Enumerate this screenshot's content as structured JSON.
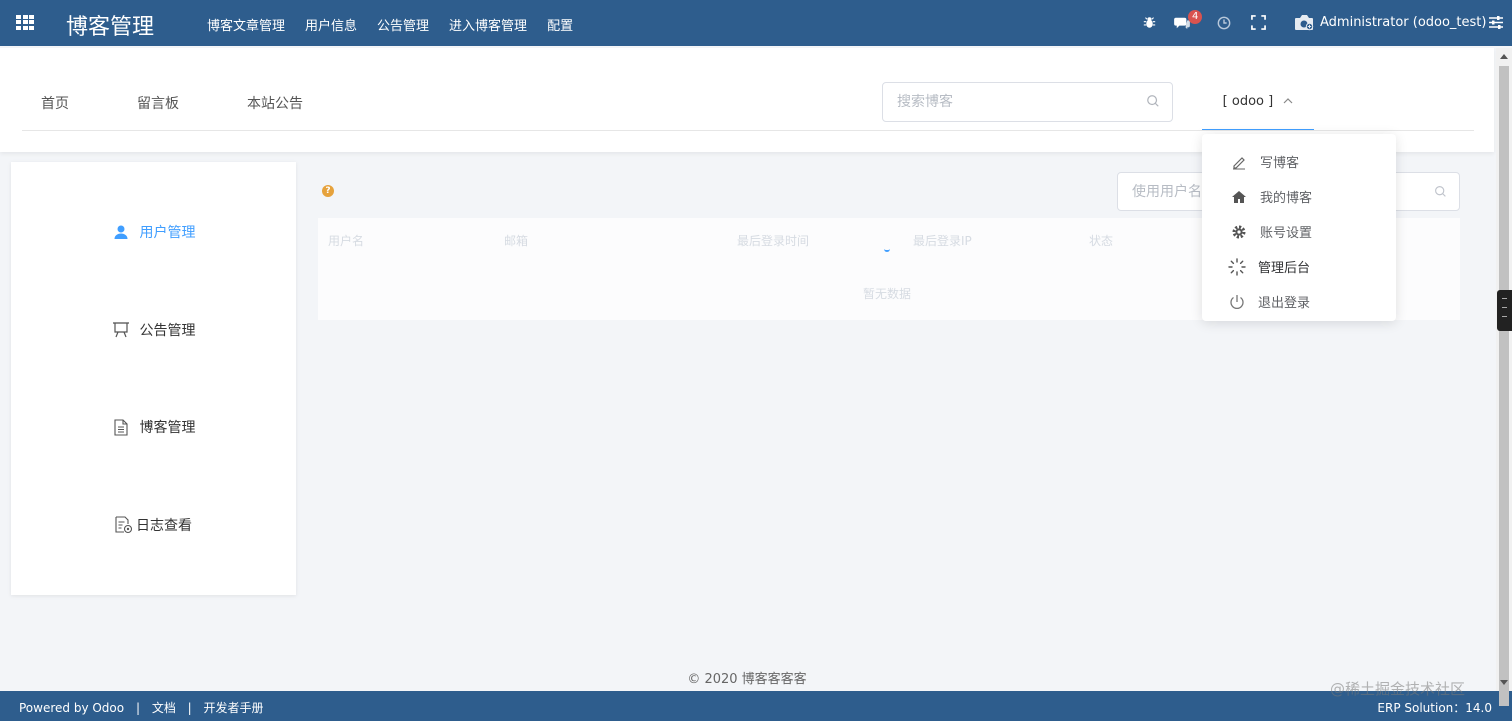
{
  "topbar": {
    "brand": "博客管理",
    "menu": [
      "博客文章管理",
      "用户信息",
      "公告管理",
      "进入博客管理",
      "配置"
    ],
    "message_count": "4",
    "user": "Administrator (odoo_test)"
  },
  "header": {
    "tabs": [
      "首页",
      "留言板",
      "本站公告"
    ],
    "search_placeholder": "搜索博客",
    "user_menu": "[ odoo ]"
  },
  "dropdown": {
    "items": [
      "写博客",
      "我的博客",
      "账号设置",
      "管理后台",
      "退出登录"
    ]
  },
  "sidebar": {
    "items": [
      "用户管理",
      "公告管理",
      "博客管理",
      "日志查看"
    ]
  },
  "content": {
    "user_search_placeholder": "使用用户名",
    "columns": [
      "用户名",
      "邮箱",
      "最后登录时间",
      "最后登录IP",
      "状态"
    ],
    "empty_text": "暂无数据"
  },
  "footer": {
    "copyright": "© 2020 博客客客客",
    "powered_by": "Powered by Odoo",
    "docs": "文档",
    "dev_manual": "开发者手册",
    "separator": "|",
    "erp": "ERP Solution：14.0",
    "watermark": "@稀土掘金技术社区"
  },
  "colors": {
    "navbar": "#2e5d8d",
    "accent": "#409eff",
    "warning": "#e6a23c",
    "badge": "#d9534f"
  },
  "icons": [
    "apps-grid-icon",
    "bug-icon",
    "chat-icon",
    "clock-icon",
    "fullscreen-icon",
    "camera-icon",
    "settings-sliders-icon",
    "search-icon",
    "chevron-up-icon",
    "edit-icon",
    "home-icon",
    "gear-icon",
    "loading-icon",
    "power-icon",
    "user-icon",
    "presentation-icon",
    "document-icon",
    "log-icon",
    "help-icon"
  ]
}
